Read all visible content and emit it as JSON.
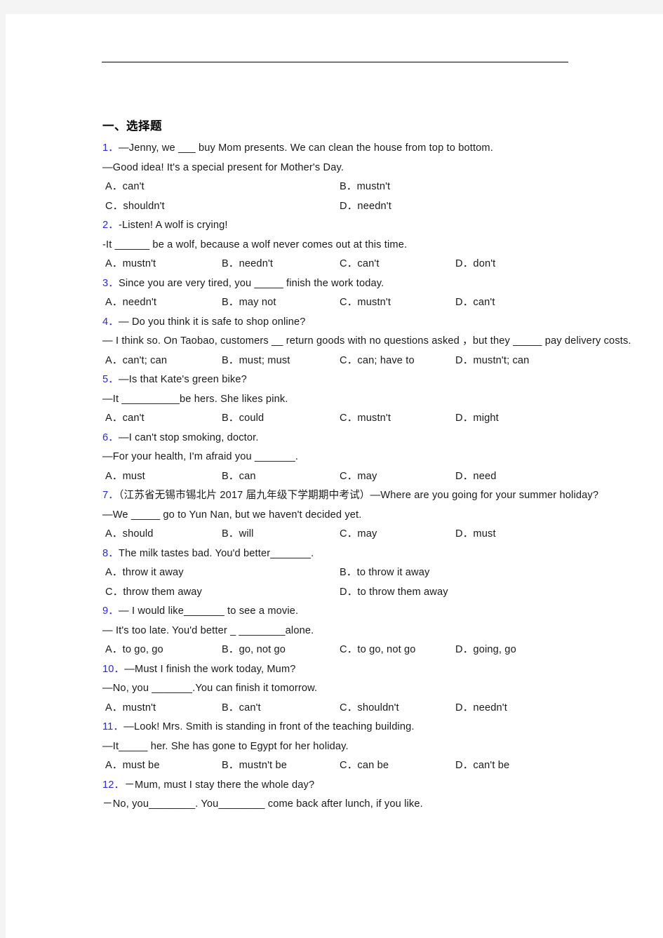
{
  "page": {
    "heading": "一、选择题"
  },
  "questions": [
    {
      "num": "1．",
      "lines": [
        "—Jenny, we ___  buy Mom presents. We can clean the house from top to bottom.",
        "—Good idea! It's a special present for Mother's Day."
      ],
      "layout": "2col",
      "options": [
        "A．can't",
        "B．mustn't",
        "C．shouldn't",
        "D．needn't"
      ]
    },
    {
      "num": "2．",
      "lines": [
        "-Listen! A wolf is crying!",
        "-It ______ be a wolf, because a wolf never comes out at this time."
      ],
      "layout": "4col",
      "options": [
        "A．mustn't",
        "B．needn't",
        "C．can't",
        "D．don't"
      ]
    },
    {
      "num": "3．",
      "lines": [
        "Since you are very tired, you _____ finish the work today."
      ],
      "layout": "4col",
      "options": [
        "A．needn't",
        "B．may not",
        "C．mustn't",
        "D．can't"
      ]
    },
    {
      "num": "4．",
      "lines": [
        "— Do you think it is safe to shop online?",
        "— I think so. On Taobao, customers  __  return goods with no questions asked ，but they _____ pay delivery costs."
      ],
      "layout": "4col",
      "options": [
        "A．can't; can",
        "B．must; must",
        "C．can; have to",
        "D．mustn't; can"
      ]
    },
    {
      "num": "5．",
      "lines": [
        "—Is that Kate's green bike?",
        "—It __________be hers. She likes pink."
      ],
      "layout": "4col",
      "options": [
        "A．can't",
        "B．could",
        "C．mustn't",
        "D．might"
      ]
    },
    {
      "num": "6．",
      "lines": [
        "—I can't stop smoking, doctor.",
        "—For your health, I'm afraid you _______."
      ],
      "layout": "4col",
      "options": [
        "A．must",
        "B．can",
        "C．may",
        "D．need"
      ]
    },
    {
      "num": "7．",
      "lines": [
        "（江苏省无锡市锡北片 2017 届九年级下学期期中考试）—Where are you going for your summer holiday?",
        "—We  _____ go to Yun Nan, but we haven't decided yet."
      ],
      "layout": "4col",
      "options": [
        "A．should",
        "B．will",
        "C．may",
        "D．must"
      ]
    },
    {
      "num": "8．",
      "lines": [
        "The milk tastes bad. You'd better_______."
      ],
      "layout": "2col",
      "options": [
        "A．throw it away",
        "B．to throw it away",
        "C．throw them away",
        "D．to throw them away"
      ]
    },
    {
      "num": "9．",
      "lines": [
        "— I would like_______ to see a movie.",
        "— It's too late. You'd better _ ________alone."
      ],
      "layout": "4col",
      "options": [
        "A．to go, go",
        "B．go, not go",
        "C．to go, not go",
        "D．going, go"
      ]
    },
    {
      "num": "10．",
      "lines": [
        "—Must I finish the work today, Mum?",
        "—No, you _______.You can finish it tomorrow."
      ],
      "layout": "4col",
      "options": [
        "A．mustn't",
        "B．can't",
        "C．shouldn't",
        "D．needn't"
      ]
    },
    {
      "num": "11．",
      "lines": [
        "—Look! Mrs. Smith is standing in front of the teaching building.",
        "—It_____ her. She has gone to Egypt for her holiday."
      ],
      "layout": "4col",
      "options": [
        "A．must be",
        "B．mustn't be",
        "C．can be",
        "D．can't be"
      ]
    },
    {
      "num": "12．",
      "lines": [
        "－Mum, must I stay there the whole day?",
        "－No, you________. You________ come back after lunch, if you like."
      ],
      "layout": "none",
      "options": []
    }
  ]
}
